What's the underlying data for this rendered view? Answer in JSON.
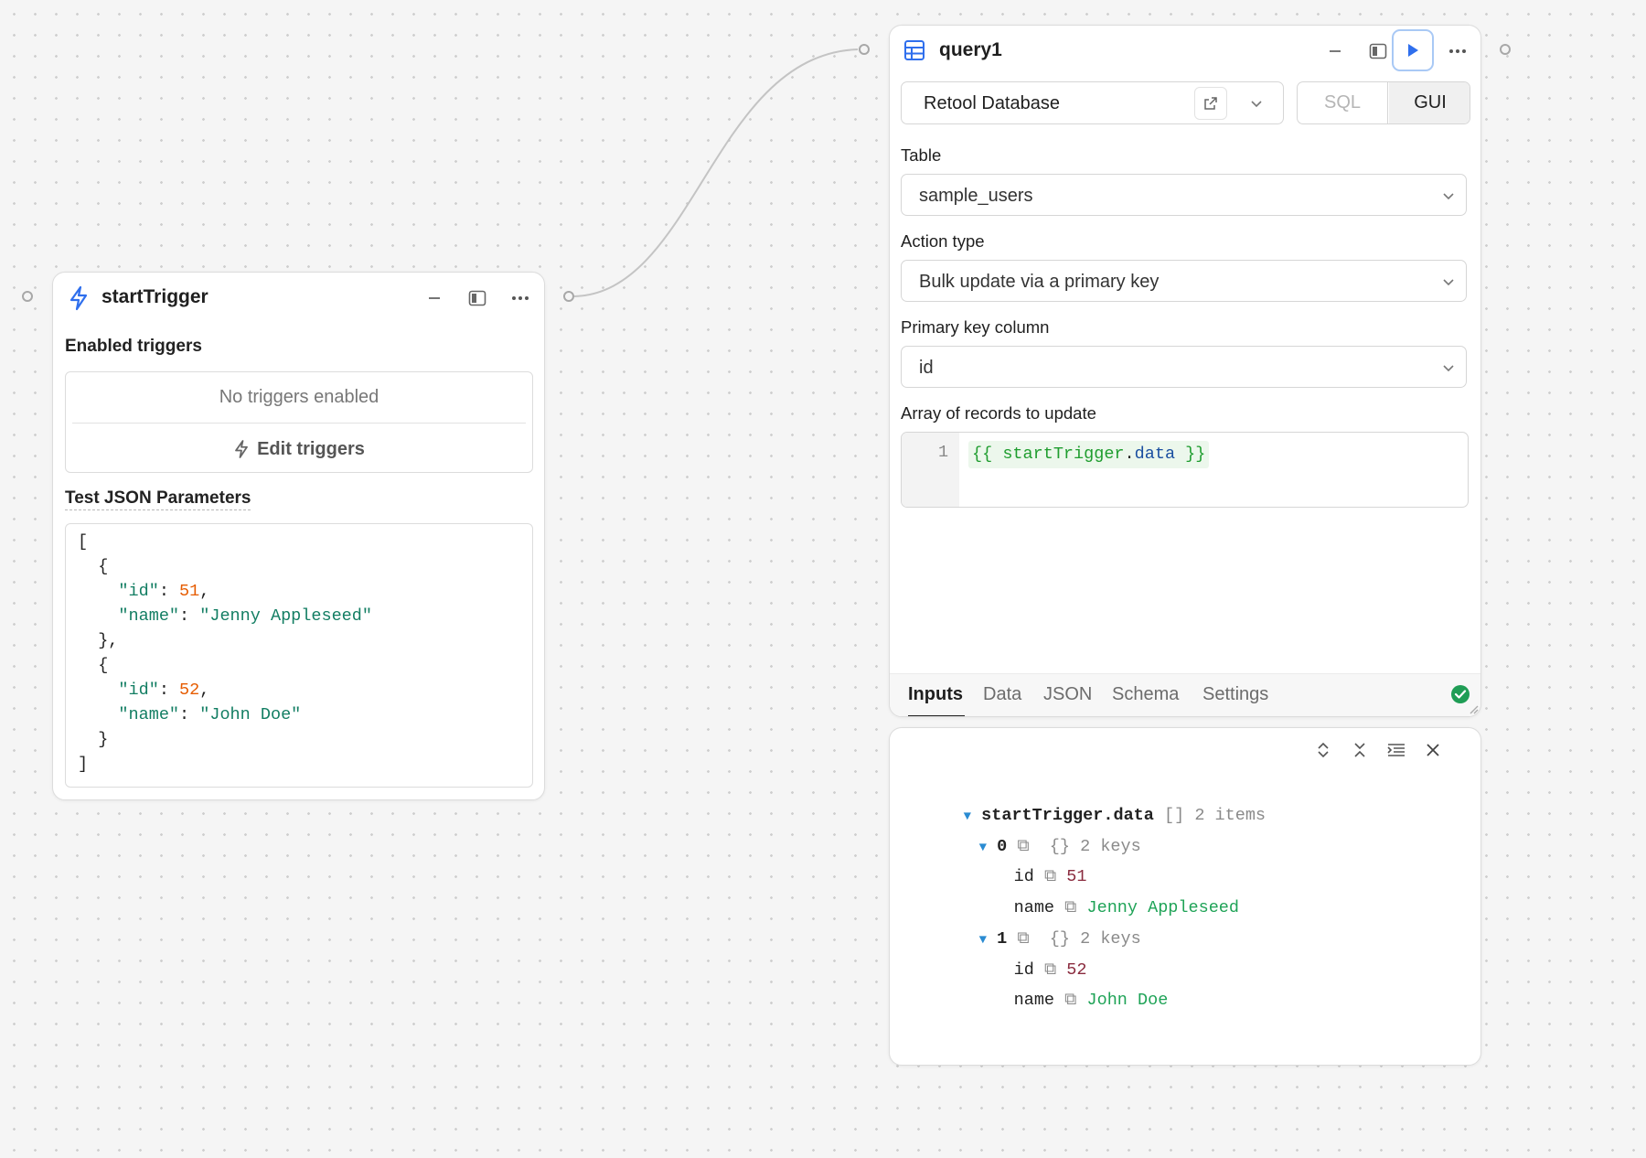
{
  "trigger": {
    "title": "startTrigger",
    "enabled_label": "Enabled triggers",
    "no_triggers": "No triggers enabled",
    "edit_triggers": "Edit triggers",
    "test_params_label": "Test JSON Parameters",
    "json_lines": [
      [
        {
          "t": "[",
          "c": ""
        }
      ],
      [
        {
          "t": "  {",
          "c": ""
        }
      ],
      [
        {
          "t": "    \"id\"",
          "c": "k"
        },
        {
          "t": ": ",
          "c": ""
        },
        {
          "t": "51",
          "c": "n"
        },
        {
          "t": ",",
          "c": ""
        }
      ],
      [
        {
          "t": "    \"name\"",
          "c": "k"
        },
        {
          "t": ": ",
          "c": ""
        },
        {
          "t": "\"Jenny Appleseed\"",
          "c": "s"
        }
      ],
      [
        {
          "t": "  },",
          "c": ""
        }
      ],
      [
        {
          "t": "  {",
          "c": ""
        }
      ],
      [
        {
          "t": "    \"id\"",
          "c": "k"
        },
        {
          "t": ": ",
          "c": ""
        },
        {
          "t": "52",
          "c": "n"
        },
        {
          "t": ",",
          "c": ""
        }
      ],
      [
        {
          "t": "    \"name\"",
          "c": "k"
        },
        {
          "t": ": ",
          "c": ""
        },
        {
          "t": "\"John Doe\"",
          "c": "s"
        }
      ],
      [
        {
          "t": "  }",
          "c": ""
        }
      ],
      [
        {
          "t": "]",
          "c": ""
        }
      ]
    ]
  },
  "query": {
    "title": "query1",
    "resource": "Retool Database",
    "mode_sql": "SQL",
    "mode_gui": "GUI",
    "table_label": "Table",
    "table_value": "sample_users",
    "action_label": "Action type",
    "action_value": "Bulk update via a primary key",
    "pk_label": "Primary key column",
    "pk_value": "id",
    "records_label": "Array of records to update",
    "records_line_no": "1",
    "records_open": "{{ ",
    "records_obj": "startTrigger",
    "records_dot": ".",
    "records_prop": "data",
    "records_close": " }}",
    "tabs": [
      "Inputs",
      "Data",
      "JSON",
      "Schema",
      "Settings"
    ],
    "active_tab": "Inputs",
    "status_color": "#1f9d55"
  },
  "inspector": {
    "root_key": "startTrigger.data",
    "root_type": "[]",
    "root_count": "2 items",
    "items": [
      {
        "index": "0",
        "type": "{}",
        "count": "2 keys",
        "id_key": "id",
        "id_val": "51",
        "name_key": "name",
        "name_val": "Jenny Appleseed"
      },
      {
        "index": "1",
        "type": "{}",
        "count": "2 keys",
        "id_key": "id",
        "id_val": "52",
        "name_key": "name",
        "name_val": "John Doe"
      }
    ]
  },
  "colors": {
    "accent": "#2f6fed",
    "play_outline": "#a9c9f5",
    "json_key": "#137e63",
    "json_number": "#e65c00"
  }
}
